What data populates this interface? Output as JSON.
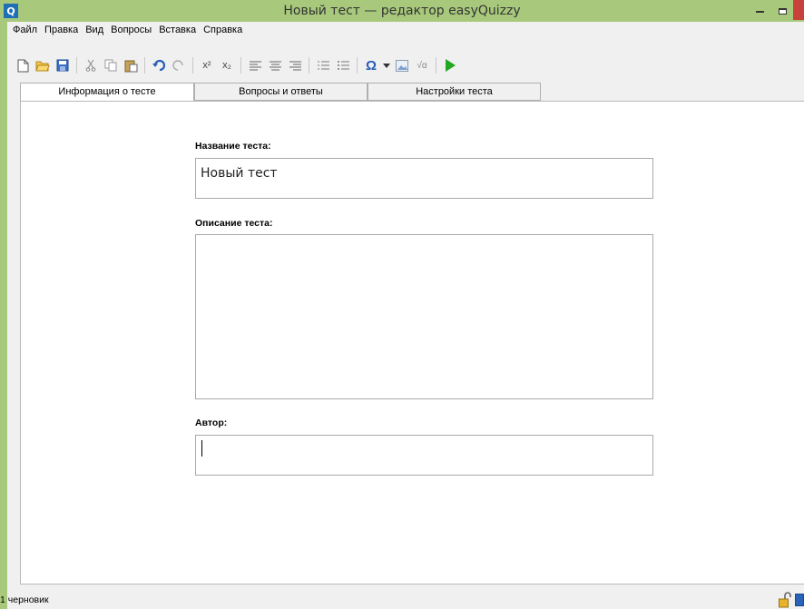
{
  "window": {
    "title": "Новый тест — редактор easyQuizzy",
    "app_icon_letter": "Q",
    "accent_color": "#a8c97c"
  },
  "menu": {
    "items": [
      "Файл",
      "Правка",
      "Вид",
      "Вопросы",
      "Вставка",
      "Справка"
    ]
  },
  "toolbar": {
    "buttons": [
      "new-file-icon",
      "open-folder-icon",
      "save-icon",
      "cut-icon",
      "copy-icon",
      "paste-icon",
      "undo-icon",
      "redo-icon",
      "superscript-icon",
      "subscript-icon",
      "align-left-icon",
      "align-center-icon",
      "align-right-icon",
      "numbered-list-icon",
      "bulleted-list-icon",
      "omega-symbol-icon",
      "dropdown-arrow-icon",
      "image-icon",
      "formula-icon",
      "play-icon"
    ],
    "superscript_label": "x²",
    "subscript_label": "x₂",
    "omega_label": "Ω",
    "formula_label": "√α"
  },
  "tabs": [
    {
      "label": "Информация о тесте",
      "active": true
    },
    {
      "label": "Вопросы и ответы",
      "active": false
    },
    {
      "label": "Настройки теста",
      "active": false
    }
  ],
  "form": {
    "title_label": "Название теста:",
    "title_value": "Новый тест",
    "description_label": "Описание теста:",
    "description_value": "",
    "author_label": "Автор:",
    "author_value": ""
  },
  "status": {
    "text": "1 черновик"
  }
}
